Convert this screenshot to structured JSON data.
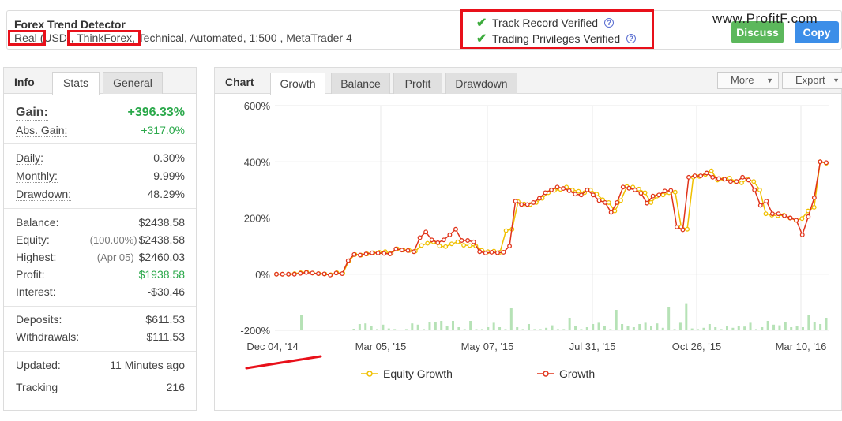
{
  "header": {
    "title": "Forex Trend Detector",
    "account_type": "Real",
    "currency": "(USD)",
    "broker": "ThinkForex",
    "details": ", Technical, Automated, 1:500 , MetaTrader 4",
    "verified": [
      "Track Record Verified",
      "Trading Privileges Verified"
    ],
    "discuss_label": "Discuss",
    "copy_label": "Copy",
    "watermark": "www.ProfitF.com"
  },
  "left_tabs": {
    "title": "Info",
    "tabs": [
      "Stats",
      "General"
    ]
  },
  "stats": {
    "gain": {
      "label": "Gain:",
      "value": "+396.33%"
    },
    "abs_gain": {
      "label": "Abs. Gain:",
      "value": "+317.0%"
    },
    "daily": {
      "label": "Daily:",
      "value": "0.30%"
    },
    "monthly": {
      "label": "Monthly:",
      "value": "9.99%"
    },
    "drawdown": {
      "label": "Drawdown:",
      "value": "48.29%"
    },
    "balance": {
      "label": "Balance:",
      "value": "$2438.58"
    },
    "equity": {
      "label": "Equity:",
      "sub": "(100.00%)",
      "value": "$2438.58"
    },
    "highest": {
      "label": "Highest:",
      "sub": "(Apr 05)",
      "value": "$2460.03"
    },
    "profit": {
      "label": "Profit:",
      "value": "$1938.58"
    },
    "interest": {
      "label": "Interest:",
      "value": "-$30.46"
    },
    "deposits": {
      "label": "Deposits:",
      "value": "$611.53"
    },
    "withdrawals": {
      "label": "Withdrawals:",
      "value": "$111.53"
    },
    "updated": {
      "label": "Updated:",
      "value": "11 Minutes ago"
    },
    "tracking": {
      "label": "Tracking",
      "value": "216"
    }
  },
  "chart_panel": {
    "title": "Chart",
    "tabs": [
      "Growth",
      "Balance",
      "Profit",
      "Drawdown"
    ],
    "more_label": "More",
    "export_label": "Export"
  },
  "chart_data": {
    "type": "line",
    "y_ticks": [
      "600%",
      "400%",
      "200%",
      "0%",
      "-200%"
    ],
    "ylim": [
      -200,
      600
    ],
    "x_tick_labels": [
      "Dec 04, '14",
      "Mar 05, '15",
      "May 07, '15",
      "Jul 31, '15",
      "Oct 26, '15",
      "Mar 10, '16"
    ],
    "grid": true,
    "legend_position": "bottom",
    "colors": {
      "equity": "#f0c000",
      "growth": "#e0331a",
      "bars": "#b6e2b6"
    },
    "series": [
      {
        "name": "Equity Growth",
        "values": [
          0,
          0,
          0,
          2,
          5,
          8,
          4,
          2,
          1,
          -2,
          5,
          3,
          48,
          70,
          68,
          72,
          76,
          78,
          80,
          74,
          90,
          86,
          84,
          82,
          102,
          110,
          115,
          100,
          98,
          108,
          115,
          103,
          102,
          100,
          85,
          80,
          82,
          78,
          155,
          160,
          258,
          250,
          248,
          255,
          270,
          290,
          298,
          302,
          310,
          300,
          295,
          290,
          300,
          285,
          265,
          255,
          225,
          262,
          312,
          310,
          303,
          290,
          255,
          278,
          282,
          290,
          292,
          168,
          160,
          345,
          348,
          355,
          368,
          335,
          338,
          342,
          330,
          325,
          338,
          330,
          300,
          215,
          210,
          208,
          210,
          200,
          192,
          198,
          225,
          238,
          400,
          395
        ],
        "x_positions": [
          0,
          1,
          2,
          3,
          4,
          5,
          6,
          7,
          8,
          9,
          10,
          11,
          12,
          13,
          14,
          15,
          16,
          17,
          18,
          19,
          20,
          21,
          22,
          23,
          24,
          25,
          26,
          27,
          28,
          29,
          30,
          31,
          32,
          33,
          34,
          35,
          36,
          37,
          38,
          39,
          40,
          41,
          42,
          43,
          44,
          45,
          46,
          47,
          48,
          49,
          50,
          51,
          52,
          53,
          54,
          55,
          56,
          57,
          58,
          59,
          60,
          61,
          62,
          63,
          64,
          65,
          66,
          67,
          68,
          69,
          70,
          71,
          72,
          73,
          74,
          75,
          76,
          77,
          78,
          79,
          80,
          81,
          82,
          83,
          84,
          85,
          86,
          87,
          88,
          89,
          90,
          91
        ]
      },
      {
        "name": "Growth",
        "values": [
          0,
          0,
          0,
          0,
          3,
          6,
          4,
          2,
          1,
          -3,
          4,
          2,
          48,
          70,
          68,
          72,
          76,
          75,
          74,
          72,
          90,
          86,
          84,
          80,
          130,
          150,
          122,
          112,
          122,
          140,
          160,
          120,
          120,
          115,
          80,
          75,
          78,
          76,
          78,
          100,
          260,
          248,
          248,
          255,
          270,
          290,
          300,
          310,
          305,
          297,
          285,
          282,
          300,
          282,
          262,
          255,
          220,
          255,
          310,
          306,
          300,
          288,
          253,
          278,
          282,
          296,
          298,
          168,
          158,
          345,
          350,
          350,
          360,
          345,
          340,
          338,
          330,
          330,
          345,
          335,
          300,
          245,
          260,
          215,
          215,
          208,
          200,
          192,
          140,
          205,
          272,
          400,
          397
        ],
        "x_positions": [
          0,
          1,
          2,
          3,
          4,
          5,
          6,
          7,
          8,
          9,
          10,
          11,
          12,
          13,
          14,
          15,
          16,
          17,
          18,
          19,
          20,
          21,
          22,
          23,
          24,
          25,
          26,
          27,
          28,
          29,
          30,
          31,
          32,
          33,
          34,
          35,
          36,
          37,
          38,
          39,
          40,
          41,
          42,
          43,
          44,
          45,
          46,
          47,
          48,
          49,
          50,
          51,
          52,
          53,
          54,
          55,
          56,
          57,
          58,
          59,
          60,
          61,
          62,
          63,
          64,
          65,
          66,
          67,
          68,
          69,
          70,
          71,
          72,
          73,
          74,
          75,
          76,
          77,
          78,
          79,
          80,
          81,
          82,
          83,
          84,
          85,
          86,
          87,
          88,
          89,
          90,
          91,
          92
        ]
      }
    ],
    "bar_values": [
      0,
      0,
      0,
      0,
      50,
      0,
      0,
      0,
      0,
      0,
      0,
      0,
      0,
      5,
      20,
      22,
      14,
      4,
      18,
      6,
      4,
      2,
      4,
      22,
      18,
      4,
      26,
      26,
      30,
      14,
      30,
      10,
      4,
      30,
      4,
      4,
      10,
      24,
      10,
      4,
      70,
      10,
      4,
      20,
      4,
      4,
      8,
      16,
      4,
      4,
      40,
      14,
      4,
      10,
      20,
      24,
      14,
      4,
      65,
      20,
      14,
      10,
      20,
      24,
      14,
      22,
      8,
      75,
      4,
      24,
      86,
      6,
      4,
      8,
      20,
      10,
      4,
      14,
      8,
      14,
      12,
      24,
      4,
      10,
      30,
      18,
      16,
      26,
      10,
      14,
      10,
      50,
      26,
      20,
      40
    ]
  }
}
